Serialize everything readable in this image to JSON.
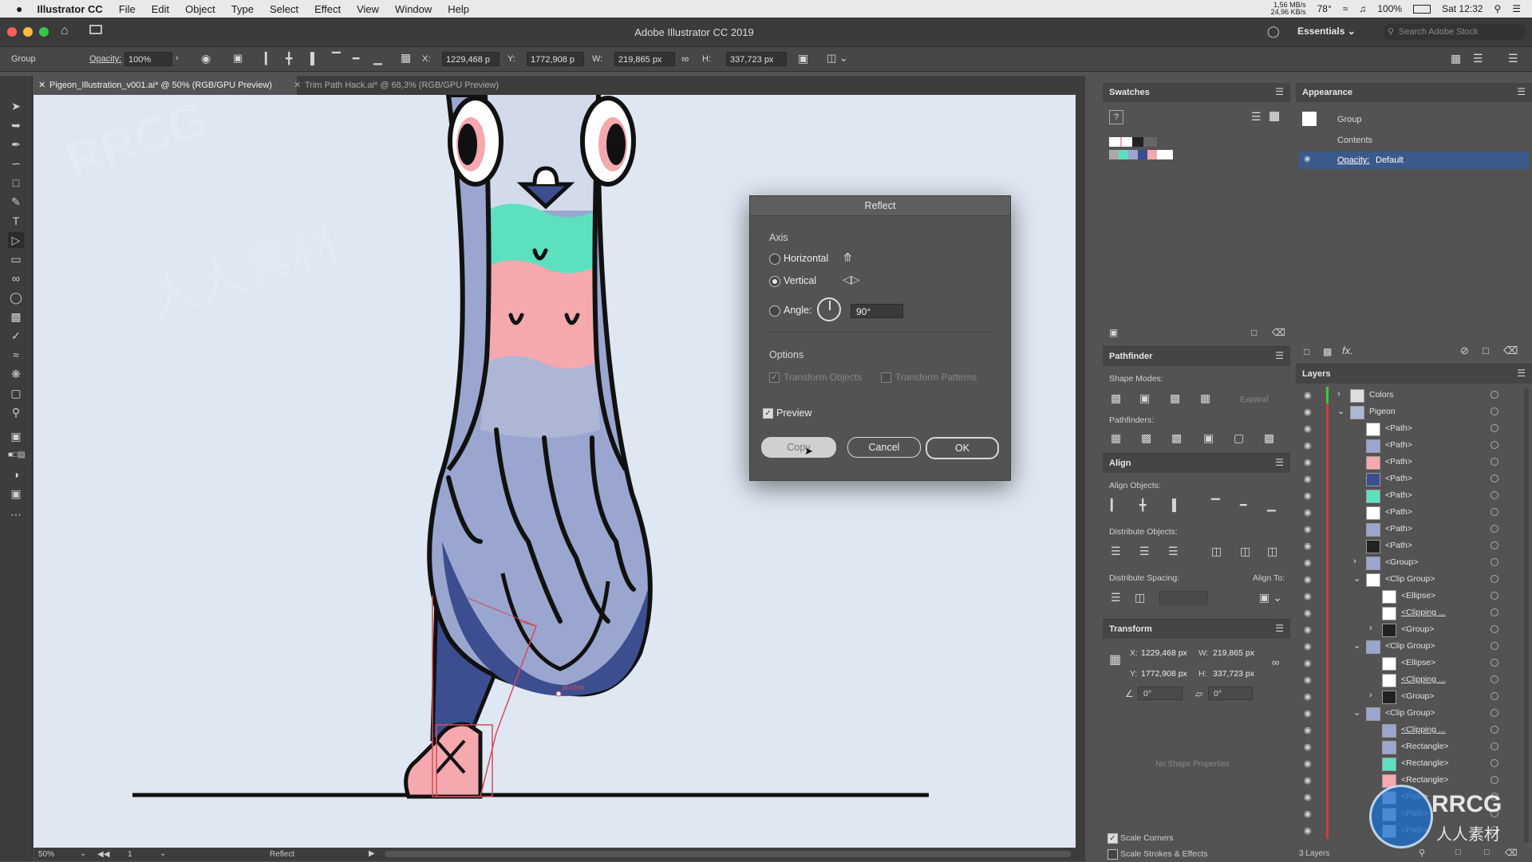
{
  "menubar": {
    "apple": "",
    "app_name": "Illustrator CC",
    "items": [
      "File",
      "Edit",
      "Object",
      "Type",
      "Select",
      "Effect",
      "View",
      "Window",
      "Help"
    ],
    "net_up": "1,56 MB/s",
    "net_down": "24,96 KB/s",
    "temp": "78°",
    "battery": "100%",
    "clock": "Sat 12:32"
  },
  "titlebar": {
    "title": "Adobe Illustrator CC 2019",
    "workspace": "Essentials",
    "search_placeholder": "Search Adobe Stock"
  },
  "controlbar": {
    "selection_label": "Group",
    "opacity_label": "Opacity:",
    "opacity_value": "100%",
    "x_label": "X:",
    "x_value": "1229,468 p",
    "y_label": "Y:",
    "y_value": "1772,908 p",
    "w_label": "W:",
    "w_value": "219,865 px",
    "h_label": "H:",
    "h_value": "337,723 px"
  },
  "tabs": [
    {
      "label": "Pigeon_Illustration_v001.ai* @ 50% (RGB/GPU Preview)"
    },
    {
      "label": "Trim Path Hack.ai* @ 68,3% (RGB/GPU Preview)"
    }
  ],
  "statusbar": {
    "zoom": "50%",
    "page": "1",
    "tool": "Reflect"
  },
  "canvas": {
    "anchor_label": "anchor"
  },
  "dialog": {
    "title": "Reflect",
    "axis_heading": "Axis",
    "horizontal": "Horizontal",
    "vertical": "Vertical",
    "angle_label": "Angle:",
    "angle_value": "90°",
    "options_heading": "Options",
    "transform_objects": "Transform Objects",
    "transform_patterns": "Transform Patterns",
    "preview": "Preview",
    "copy": "Copy",
    "cancel": "Cancel",
    "ok": "OK"
  },
  "swatches": {
    "title": "Swatches"
  },
  "pathfinder": {
    "title": "Pathfinder",
    "shape_modes": "Shape Modes:",
    "expand": "Expand",
    "pathfinders": "Pathfinders:"
  },
  "align": {
    "title": "Align",
    "align_objects": "Align Objects:",
    "distribute_objects": "Distribute Objects:",
    "distribute_spacing": "Distribute Spacing:",
    "align_to": "Align To:"
  },
  "transform": {
    "title": "Transform",
    "x_label": "X:",
    "x_value": "1229,468 px",
    "y_label": "Y:",
    "y_value": "1772,908 px",
    "w_label": "W:",
    "w_value": "219,865 px",
    "h_label": "H:",
    "h_value": "337,723 px",
    "rotate_value": "0°",
    "shear_value": "0°",
    "no_shape": "No Shape Properties",
    "scale_corners": "Scale Corners",
    "scale_strokes": "Scale Strokes & Effects"
  },
  "appearance": {
    "title": "Appearance",
    "group": "Group",
    "contents": "Contents",
    "opacity_label": "Opacity:",
    "opacity_value": "Default"
  },
  "layers": {
    "title": "Layers",
    "count": "3 Layers",
    "rows": [
      {
        "name": "Colors",
        "indent": 0,
        "arrow": "›"
      },
      {
        "name": "Pigeon",
        "indent": 0,
        "arrow": "⌄"
      },
      {
        "name": "<Path>",
        "indent": 1,
        "arrow": ""
      },
      {
        "name": "<Path>",
        "indent": 1,
        "arrow": ""
      },
      {
        "name": "<Path>",
        "indent": 1,
        "arrow": ""
      },
      {
        "name": "<Path>",
        "indent": 1,
        "arrow": ""
      },
      {
        "name": "<Path>",
        "indent": 1,
        "arrow": ""
      },
      {
        "name": "<Path>",
        "indent": 1,
        "arrow": ""
      },
      {
        "name": "<Path>",
        "indent": 1,
        "arrow": ""
      },
      {
        "name": "<Path>",
        "indent": 1,
        "arrow": ""
      },
      {
        "name": "<Group>",
        "indent": 1,
        "arrow": "›"
      },
      {
        "name": "<Clip Group>",
        "indent": 1,
        "arrow": "⌄"
      },
      {
        "name": "<Ellipse>",
        "indent": 2,
        "arrow": ""
      },
      {
        "name": "<Clipping ...",
        "indent": 2,
        "arrow": ""
      },
      {
        "name": "<Group>",
        "indent": 2,
        "arrow": "›"
      },
      {
        "name": "<Clip Group>",
        "indent": 1,
        "arrow": "⌄"
      },
      {
        "name": "<Ellipse>",
        "indent": 2,
        "arrow": ""
      },
      {
        "name": "<Clipping ...",
        "indent": 2,
        "arrow": ""
      },
      {
        "name": "<Group>",
        "indent": 2,
        "arrow": "›"
      },
      {
        "name": "<Clip Group>",
        "indent": 1,
        "arrow": "⌄"
      },
      {
        "name": "<Clipping ...",
        "indent": 2,
        "arrow": ""
      },
      {
        "name": "<Rectangle>",
        "indent": 2,
        "arrow": ""
      },
      {
        "name": "<Rectangle>",
        "indent": 2,
        "arrow": ""
      },
      {
        "name": "<Rectangle>",
        "indent": 2,
        "arrow": ""
      },
      {
        "name": "<Path>",
        "indent": 2,
        "arrow": ""
      },
      {
        "name": "<Path>",
        "indent": 2,
        "arrow": ""
      },
      {
        "name": "<Path>",
        "indent": 2,
        "arrow": ""
      }
    ]
  },
  "watermark": {
    "brand": "RRCG",
    "sub": "人人素材"
  },
  "colors": {
    "ui_dark": "#3d3d3d",
    "panel": "#535353",
    "canvas": "#dfe7f3",
    "selection_blue": "#3a66a8",
    "pigeon_teal": "#5ce0c0",
    "pigeon_pink": "#f5a9ae",
    "pigeon_body": "#7d8dbb",
    "pigeon_dark": "#3c4e8f"
  }
}
